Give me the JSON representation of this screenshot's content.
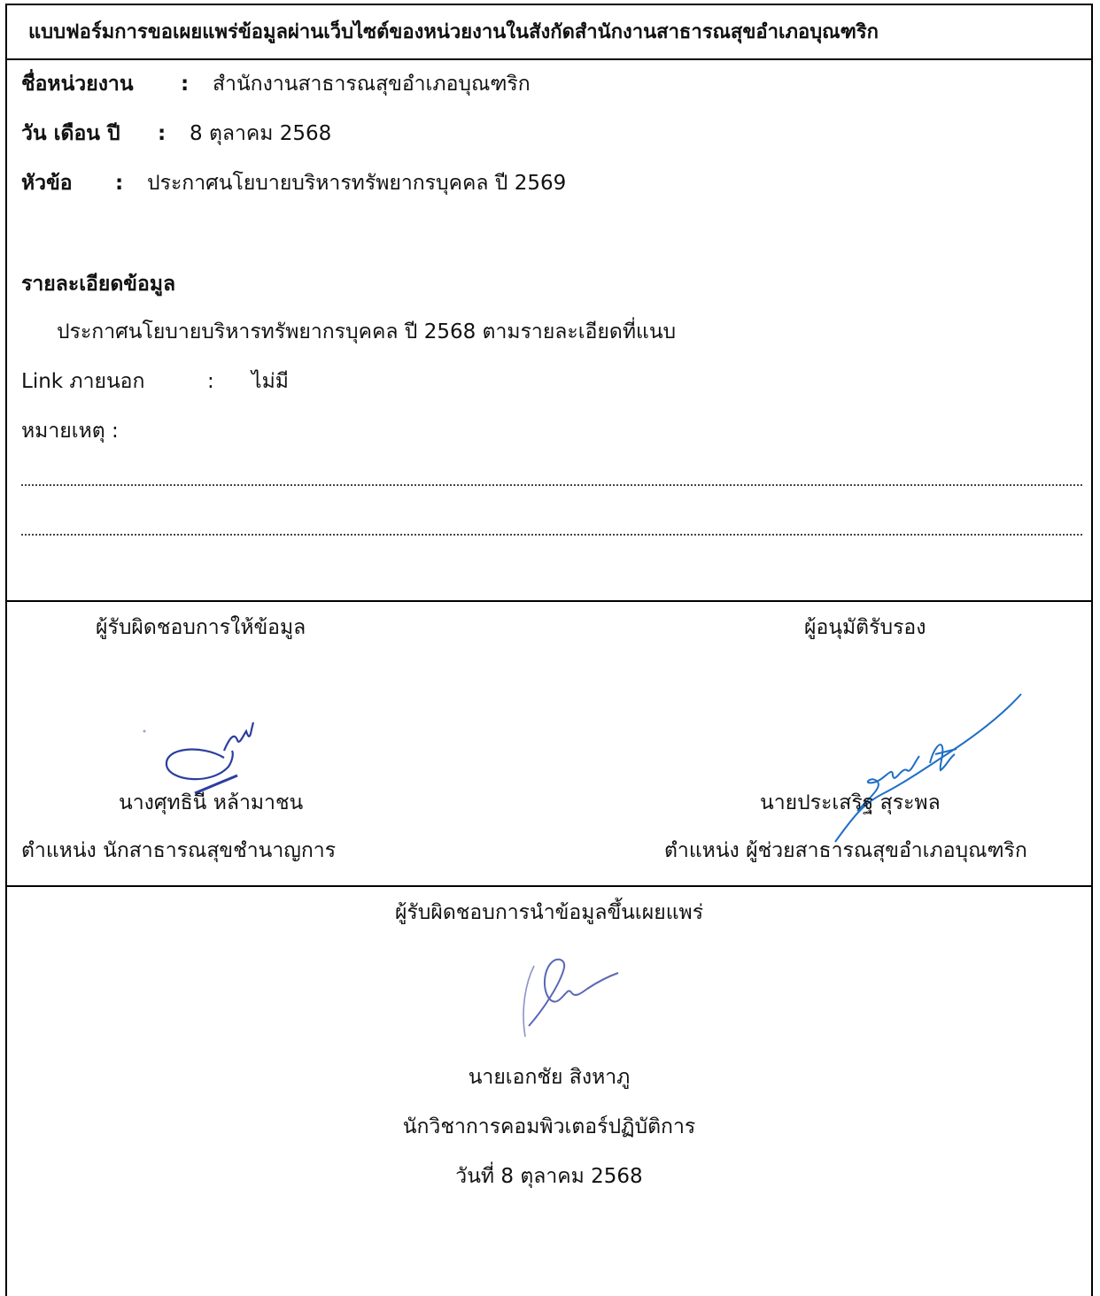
{
  "title": "แบบฟอร์มการขอเผยแพร่ข้อมูลผ่านเว็บไซต์ของหน่วยงานในสังกัดสำนักงานสาธารณสุขอำเภอบุณฑริก",
  "info": {
    "agency_label": "ชื่อหน่วยงาน",
    "agency_colon": ":",
    "agency_value": "สำนักงานสาธารณสุขอำเภอบุณฑริก",
    "date_label": "วัน เดือน ปี",
    "date_colon": ":",
    "date_value": "8 ตุลาคม 2568",
    "topic_label": "หัวข้อ",
    "topic_colon": ":",
    "topic_value": "ประกาศนโยบายบริหารทรัพยากรบุคคล ปี 2569"
  },
  "details": {
    "heading": "รายละเอียดข้อมูล",
    "text": "ประกาศนโยบายบริหารทรัพยากรบุคคล ปี 2568   ตามรายละเอียดที่แนบ",
    "link_label": "Link ภายนอก",
    "link_colon": ":",
    "link_value": "ไม่มี",
    "remark_label": "หมายเหตุ  :"
  },
  "signatures": {
    "provider": {
      "role": "ผู้รับผิดชอบการให้ข้อมูล",
      "name": "นางศุทธินี  หล้ามาชน",
      "position": "ตำแหน่ง  นักสาธารณสุขชำนาญการ"
    },
    "approver": {
      "role": "ผู้อนุมัติรับรอง",
      "name": "นายประเสริฐ  สุระพล",
      "position": "ตำแหน่ง  ผู้ช่วยสาธารณสุขอำเภอบุณฑริก"
    },
    "publisher": {
      "role": "ผู้รับผิดชอบการนำข้อมูลขึ้นเผยแพร่",
      "name": "นายเอกชัย  สิงหาภู",
      "position": "นักวิชาการคอมพิวเตอร์ปฏิบัติการ",
      "date": "วันที่ 8 ตุลาคม 2568"
    }
  },
  "colors": {
    "border": "#000000",
    "signature_navy": "#2c3e9e",
    "signature_blue": "#1f6fc4"
  }
}
